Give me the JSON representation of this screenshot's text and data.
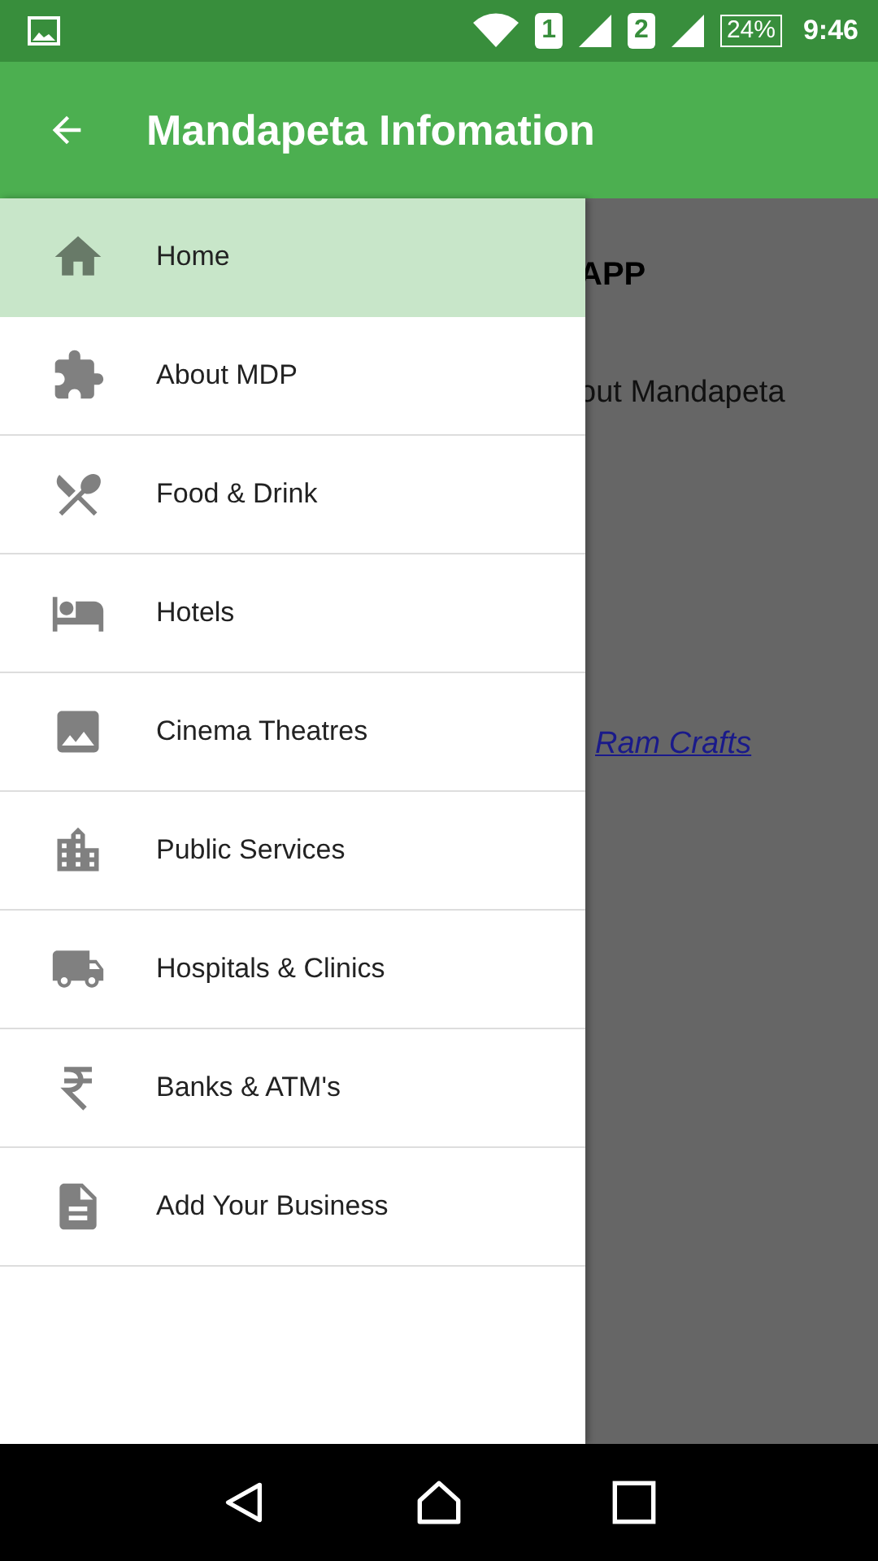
{
  "status_bar": {
    "sim_1": "1",
    "sim_2": "2",
    "battery": "24%",
    "time": "9:46"
  },
  "toolbar": {
    "title": "Mandapeta Infomation"
  },
  "background_content": {
    "heading": "APP",
    "line": "out Mandapeta",
    "link": "Ram Crafts"
  },
  "drawer": {
    "items": [
      {
        "label": "Home",
        "selected": true
      },
      {
        "label": "About MDP",
        "selected": false
      },
      {
        "label": "Food & Drink",
        "selected": false
      },
      {
        "label": "Hotels",
        "selected": false
      },
      {
        "label": "Cinema Theatres",
        "selected": false
      },
      {
        "label": "Public Services",
        "selected": false
      },
      {
        "label": "Hospitals & Clinics",
        "selected": false
      },
      {
        "label": "Banks & ATM's",
        "selected": false
      },
      {
        "label": "Add Your Business",
        "selected": false
      }
    ]
  }
}
